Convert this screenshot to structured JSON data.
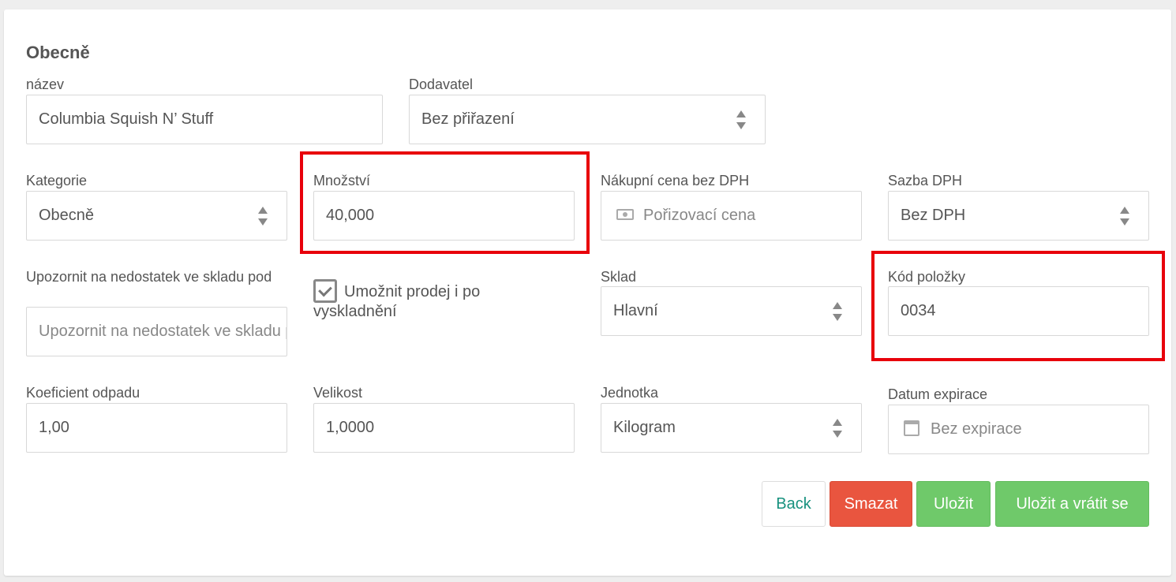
{
  "section": {
    "title": "Obecně"
  },
  "fields": {
    "name": {
      "label": "název",
      "value": "Columbia Squish N’ Stuff"
    },
    "supplier": {
      "label": "Dodavatel",
      "value": "Bez přiřazení"
    },
    "category": {
      "label": "Kategorie",
      "value": "Obecně"
    },
    "quantity": {
      "label": "Množství",
      "value": "40,000"
    },
    "purchase_price": {
      "label": "Nákupní cena bez DPH",
      "placeholder": "Pořizovací cena",
      "icon": "money-icon"
    },
    "vat_rate": {
      "label": "Sazba DPH",
      "value": "Bez DPH"
    },
    "low_stock": {
      "label": "Upozornit na nedostatek ve skladu pod",
      "placeholder": "Upozornit na nedostatek ve skladu pod"
    },
    "allow_sale": {
      "label": "Umožnit prodej i po vyskladnění",
      "checked": true
    },
    "warehouse": {
      "label": "Sklad",
      "value": "Hlavní"
    },
    "item_code": {
      "label": "Kód položky",
      "value": "0034"
    },
    "waste_coef": {
      "label": "Koeficient odpadu",
      "value": "1,00"
    },
    "size": {
      "label": "Velikost",
      "value": "1,0000"
    },
    "unit": {
      "label": "Jednotka",
      "value": "Kilogram"
    },
    "expiry": {
      "label": "Datum expirace",
      "placeholder": "Bez expirace",
      "icon": "calendar-icon"
    }
  },
  "buttons": {
    "back": "Back",
    "delete": "Smazat",
    "save": "Uložit",
    "save_return": "Uložit a vrátit se"
  },
  "colors": {
    "highlight": "#e8000b",
    "delete": "#e9553f",
    "save": "#6fc96a",
    "back_text": "#17917e"
  }
}
